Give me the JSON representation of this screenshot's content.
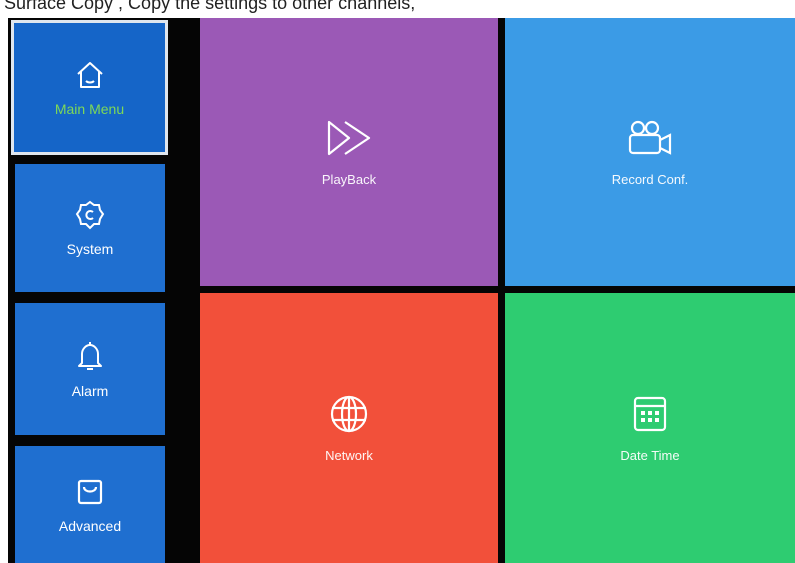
{
  "caption": "Surface  Copy , Copy the settings to other channels,",
  "colors": {
    "sidebar_item": "#1f6fd0",
    "sidebar_active": "#1565c8",
    "active_label": "#7ed957",
    "playback_tile": "#9b59b6",
    "record_tile": "#3b9be6",
    "network_tile": "#f2503a",
    "datetime_tile": "#2ecc71"
  },
  "sidebar": {
    "items": [
      {
        "label": "Main Menu",
        "icon": "home-icon",
        "active": true
      },
      {
        "label": "System",
        "icon": "gear-icon",
        "active": false
      },
      {
        "label": "Alarm",
        "icon": "bell-icon",
        "active": false
      },
      {
        "label": "Advanced",
        "icon": "bag-icon",
        "active": false
      }
    ]
  },
  "tiles": [
    {
      "label": "PlayBack",
      "icon": "fast-forward-icon"
    },
    {
      "label": "Record Conf.",
      "icon": "video-camera-icon"
    },
    {
      "label": "Network",
      "icon": "globe-icon"
    },
    {
      "label": "Date Time",
      "icon": "calendar-icon"
    }
  ]
}
